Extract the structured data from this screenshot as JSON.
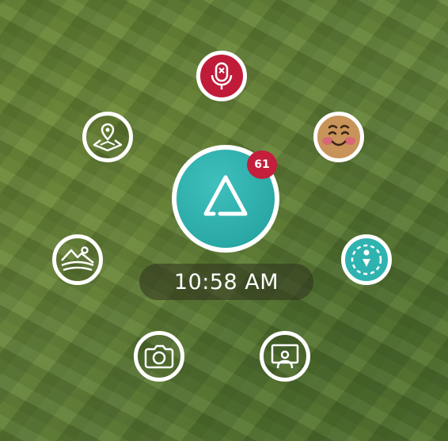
{
  "hud": {
    "notification_count": "61",
    "clock_time": "10:58 AM"
  },
  "buttons": [
    {
      "name": "mute-microphone-button",
      "icon": "microphone-muted-icon",
      "color": "#c01c3a"
    },
    {
      "name": "map-location-button",
      "icon": "map-pin-icon"
    },
    {
      "name": "emoji-button",
      "icon": "smiling-face-icon",
      "color": "#c8945a"
    },
    {
      "name": "gallery-button",
      "icon": "landscape-image-icon"
    },
    {
      "name": "compass-button",
      "icon": "compass-icon",
      "color": "#2fb3b0"
    },
    {
      "name": "camera-button",
      "icon": "camera-icon"
    },
    {
      "name": "share-screen-button",
      "icon": "screen-share-person-icon"
    }
  ],
  "main_menu": {
    "icon": "triangle-logo-icon",
    "color": "#2aa9a6"
  },
  "colors": {
    "badge": "#c41e3c",
    "ring": "#ffffff"
  }
}
